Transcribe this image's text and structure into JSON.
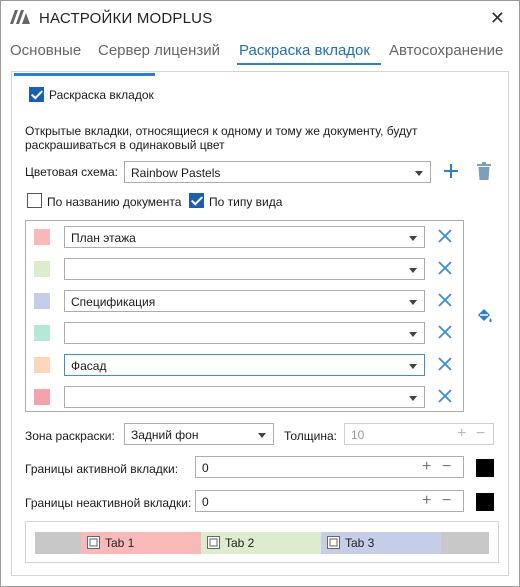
{
  "window": {
    "title": "НАСТРОЙКИ MODPLUS"
  },
  "tabs": [
    {
      "label": "Основные"
    },
    {
      "label": "Сервер лицензий"
    },
    {
      "label": "Раскраска вкладок"
    },
    {
      "label": "Автосохранение"
    }
  ],
  "active_tab": "Раскраска вкладок",
  "coloring": {
    "enable_label": "Раскраска вкладок",
    "enable_checked": true,
    "description_line1": "Открытые вкладки, относящиеся к одному и тому же документу, будут",
    "description_line2": "раскрашиваться в одинаковый цвет",
    "scheme_label": "Цветовая схема:",
    "scheme_value": "Rainbow Pastels",
    "by_doc_name_label": "По названию документа",
    "by_doc_name_checked": false,
    "by_view_type_label": "По типу вида",
    "by_view_type_checked": true
  },
  "rules": [
    {
      "color": "#f9b9b9",
      "value": "План этажа"
    },
    {
      "color": "#ddeccd",
      "value": ""
    },
    {
      "color": "#c5cde9",
      "value": "Спецификация"
    },
    {
      "color": "#b5e8d5",
      "value": ""
    },
    {
      "color": "#fcd6bb",
      "value": "Фасад"
    },
    {
      "color": "#f5a3aa",
      "value": ""
    }
  ],
  "zone": {
    "label": "Зона раскраски:",
    "value": "Задний фон",
    "thickness_label": "Толщина:",
    "thickness_value": "10"
  },
  "active_border": {
    "label": "Границы активной вкладки:",
    "value": "0",
    "color": "#000000"
  },
  "inactive_border": {
    "label": "Границы неактивной вкладки:",
    "value": "0",
    "color": "#000000"
  },
  "preview": {
    "tabs": [
      {
        "label": "Tab 1",
        "color": "#f9b9b9"
      },
      {
        "label": "Tab 2",
        "color": "#ddeccd"
      },
      {
        "label": "Tab 3",
        "color": "#c5cde9"
      }
    ]
  },
  "accent_color": "#2a7fd0"
}
